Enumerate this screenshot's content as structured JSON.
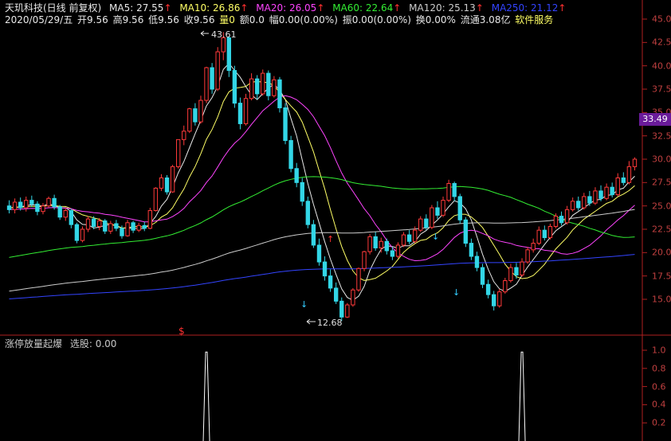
{
  "header": {
    "stock_title": "天玑科技(日线 前复权)",
    "ma": [
      {
        "label": "MA5: 27.55",
        "arrow": "↑",
        "color": "#e8e8e8"
      },
      {
        "label": "MA10: 26.86",
        "arrow": "↑",
        "color": "#ffff66"
      },
      {
        "label": "MA20: 26.05",
        "arrow": "↑",
        "color": "#ff44ff"
      },
      {
        "label": "MA60: 22.64",
        "arrow": "↑",
        "color": "#33ee33"
      },
      {
        "label": "MA120: 25.13",
        "arrow": "↑",
        "color": "#cccccc"
      },
      {
        "label": "MA250: 21.12",
        "arrow": "↑",
        "color": "#3344ff"
      }
    ],
    "date": "2020/05/29/五",
    "open": "开9.56",
    "high": "高9.56",
    "low": "低9.56",
    "close": "收9.56",
    "vol_label": "量0",
    "amount": "额0.0",
    "change": "幅0.00(0.00%)",
    "amplitude": "振0.00(0.00%)",
    "turnover": "换0.00%",
    "float_cap": "流通3.08亿",
    "service": "软件服务"
  },
  "price_badge": "33.49",
  "annotations": {
    "high_label": "43.61",
    "low_label": "12.68",
    "signal_marker": "$"
  },
  "axis_main": [
    "45.0",
    "42.5",
    "40.0",
    "37.5",
    "35.0",
    "32.5",
    "30.0",
    "27.5",
    "25.0",
    "22.5",
    "20.0",
    "17.5",
    "15.0"
  ],
  "indicator": {
    "title": "涨停放量起爆",
    "value_label": "选股: 0.00"
  },
  "axis_sub": [
    "1.0",
    "0.8",
    "0.6",
    "0.4",
    "0.2"
  ],
  "chart_data": {
    "type": "candlestick",
    "candles": [
      [
        25.0,
        24.6,
        25.6,
        24.2
      ],
      [
        24.6,
        25.4,
        25.8,
        24.2
      ],
      [
        25.4,
        24.8,
        25.9,
        24.5
      ],
      [
        24.8,
        25.6,
        26.0,
        24.4
      ],
      [
        25.6,
        25.2,
        26.1,
        24.9
      ],
      [
        25.2,
        24.4,
        25.5,
        24.0
      ],
      [
        24.4,
        25.0,
        25.3,
        24.1
      ],
      [
        25.0,
        25.8,
        26.0,
        24.8
      ],
      [
        25.8,
        24.9,
        26.2,
        24.6
      ],
      [
        24.9,
        23.8,
        25.1,
        23.5
      ],
      [
        23.8,
        24.5,
        24.8,
        23.4
      ],
      [
        24.5,
        23.0,
        24.7,
        22.6
      ],
      [
        23.0,
        21.3,
        23.2,
        21.0
      ],
      [
        21.3,
        22.5,
        22.8,
        21.1
      ],
      [
        22.5,
        23.6,
        23.9,
        22.2
      ],
      [
        23.6,
        22.8,
        23.9,
        22.5
      ],
      [
        22.8,
        23.4,
        23.7,
        22.4
      ],
      [
        23.4,
        22.3,
        23.6,
        22.0
      ],
      [
        22.3,
        23.1,
        23.4,
        22.0
      ],
      [
        23.1,
        22.6,
        23.5,
        22.3
      ],
      [
        22.6,
        21.8,
        22.9,
        21.5
      ],
      [
        21.8,
        23.2,
        23.5,
        21.7
      ],
      [
        23.2,
        22.4,
        23.4,
        22.1
      ],
      [
        22.4,
        22.9,
        23.2,
        22.2
      ],
      [
        22.9,
        22.6,
        23.3,
        22.3
      ],
      [
        22.6,
        24.5,
        24.8,
        22.5
      ],
      [
        24.5,
        26.9,
        27.0,
        24.4
      ],
      [
        26.9,
        28.0,
        28.4,
        26.6
      ],
      [
        28.0,
        26.5,
        28.3,
        26.2
      ],
      [
        26.5,
        29.2,
        29.4,
        26.4
      ],
      [
        29.2,
        32.1,
        32.1,
        29.0
      ],
      [
        32.1,
        33.0,
        33.6,
        31.5
      ],
      [
        33.0,
        35.4,
        35.5,
        32.8
      ],
      [
        35.4,
        34.0,
        36.0,
        33.6
      ],
      [
        34.0,
        36.3,
        36.8,
        33.8
      ],
      [
        36.3,
        39.8,
        39.9,
        36.0
      ],
      [
        39.8,
        37.5,
        40.3,
        37.0
      ],
      [
        37.5,
        41.5,
        42.0,
        37.3
      ],
      [
        41.5,
        43.0,
        43.61,
        40.6
      ],
      [
        43.0,
        39.5,
        43.2,
        38.8
      ],
      [
        39.5,
        36.0,
        40.0,
        35.5
      ],
      [
        36.0,
        33.8,
        36.6,
        33.2
      ],
      [
        33.8,
        36.5,
        37.0,
        33.6
      ],
      [
        36.5,
        38.6,
        39.2,
        36.3
      ],
      [
        38.6,
        37.0,
        39.0,
        36.4
      ],
      [
        37.0,
        39.2,
        39.6,
        36.8
      ],
      [
        39.2,
        36.8,
        39.5,
        36.3
      ],
      [
        36.8,
        38.5,
        38.9,
        36.6
      ],
      [
        38.5,
        35.5,
        38.8,
        35.0
      ],
      [
        35.5,
        32.0,
        36.0,
        31.6
      ],
      [
        32.0,
        29.0,
        32.5,
        28.6
      ],
      [
        29.0,
        27.5,
        29.6,
        27.0
      ],
      [
        27.5,
        25.5,
        28.0,
        25.0
      ],
      [
        25.5,
        23.0,
        26.0,
        22.6
      ],
      [
        23.0,
        20.8,
        23.5,
        20.5
      ],
      [
        20.8,
        19.0,
        21.5,
        18.6
      ],
      [
        19.0,
        17.5,
        19.6,
        17.0
      ],
      [
        17.5,
        16.2,
        18.2,
        15.8
      ],
      [
        16.2,
        14.8,
        16.8,
        14.5
      ],
      [
        14.8,
        13.1,
        15.2,
        12.68
      ],
      [
        13.1,
        14.4,
        14.6,
        13.0
      ],
      [
        14.4,
        16.0,
        16.2,
        14.2
      ],
      [
        16.0,
        18.3,
        18.4,
        15.8
      ],
      [
        18.3,
        20.1,
        20.2,
        18.0
      ],
      [
        20.1,
        21.7,
        22.0,
        19.8
      ],
      [
        21.7,
        20.5,
        22.2,
        20.2
      ],
      [
        20.5,
        21.2,
        21.6,
        20.0
      ],
      [
        21.2,
        20.2,
        21.5,
        19.8
      ],
      [
        20.2,
        19.6,
        20.6,
        19.2
      ],
      [
        19.6,
        20.8,
        21.1,
        19.4
      ],
      [
        20.8,
        21.9,
        22.2,
        20.6
      ],
      [
        21.9,
        21.2,
        22.4,
        20.9
      ],
      [
        21.2,
        22.4,
        22.8,
        21.0
      ],
      [
        22.4,
        23.6,
        23.9,
        22.2
      ],
      [
        23.6,
        22.7,
        24.1,
        22.4
      ],
      [
        22.7,
        24.8,
        25.1,
        22.5
      ],
      [
        24.8,
        24.0,
        25.5,
        23.6
      ],
      [
        24.0,
        25.6,
        26.0,
        23.8
      ],
      [
        25.6,
        27.4,
        27.8,
        25.4
      ],
      [
        27.4,
        26.0,
        27.6,
        25.5
      ],
      [
        26.0,
        23.5,
        26.3,
        23.1
      ],
      [
        23.5,
        21.0,
        23.8,
        20.6
      ],
      [
        21.0,
        19.6,
        21.5,
        19.2
      ],
      [
        19.6,
        18.4,
        20.1,
        18.0
      ],
      [
        18.4,
        16.6,
        18.8,
        16.2
      ],
      [
        16.6,
        15.5,
        17.1,
        15.1
      ],
      [
        15.5,
        14.3,
        15.9,
        13.8
      ],
      [
        14.3,
        15.8,
        16.1,
        14.1
      ],
      [
        15.8,
        17.0,
        17.3,
        15.6
      ],
      [
        17.0,
        18.4,
        18.8,
        16.8
      ],
      [
        18.4,
        17.6,
        18.9,
        17.2
      ],
      [
        17.6,
        19.0,
        19.4,
        17.4
      ],
      [
        19.0,
        20.3,
        20.6,
        18.8
      ],
      [
        20.3,
        21.0,
        21.5,
        20.0
      ],
      [
        21.0,
        22.4,
        22.8,
        20.8
      ],
      [
        22.4,
        21.6,
        22.9,
        21.3
      ],
      [
        21.6,
        22.8,
        23.1,
        21.4
      ],
      [
        22.8,
        23.9,
        24.2,
        22.6
      ],
      [
        23.9,
        23.2,
        24.4,
        22.9
      ],
      [
        23.2,
        24.6,
        25.0,
        23.0
      ],
      [
        24.6,
        25.5,
        25.9,
        24.4
      ],
      [
        25.5,
        24.8,
        26.0,
        24.5
      ],
      [
        24.8,
        26.0,
        26.4,
        24.6
      ],
      [
        26.0,
        25.3,
        26.6,
        25.0
      ],
      [
        25.3,
        26.6,
        27.0,
        25.1
      ],
      [
        26.6,
        25.8,
        27.2,
        25.5
      ],
      [
        25.8,
        27.0,
        27.4,
        25.6
      ],
      [
        27.0,
        26.2,
        27.5,
        25.9
      ],
      [
        26.2,
        28.0,
        28.5,
        26.0
      ],
      [
        28.0,
        27.5,
        28.6,
        27.2
      ],
      [
        27.5,
        29.2,
        29.8,
        27.3
      ],
      [
        29.2,
        30.0,
        30.2,
        28.8
      ]
    ],
    "y_range": [
      12.0,
      46.5
    ],
    "signals": [
      0.98,
      0.98
    ]
  }
}
